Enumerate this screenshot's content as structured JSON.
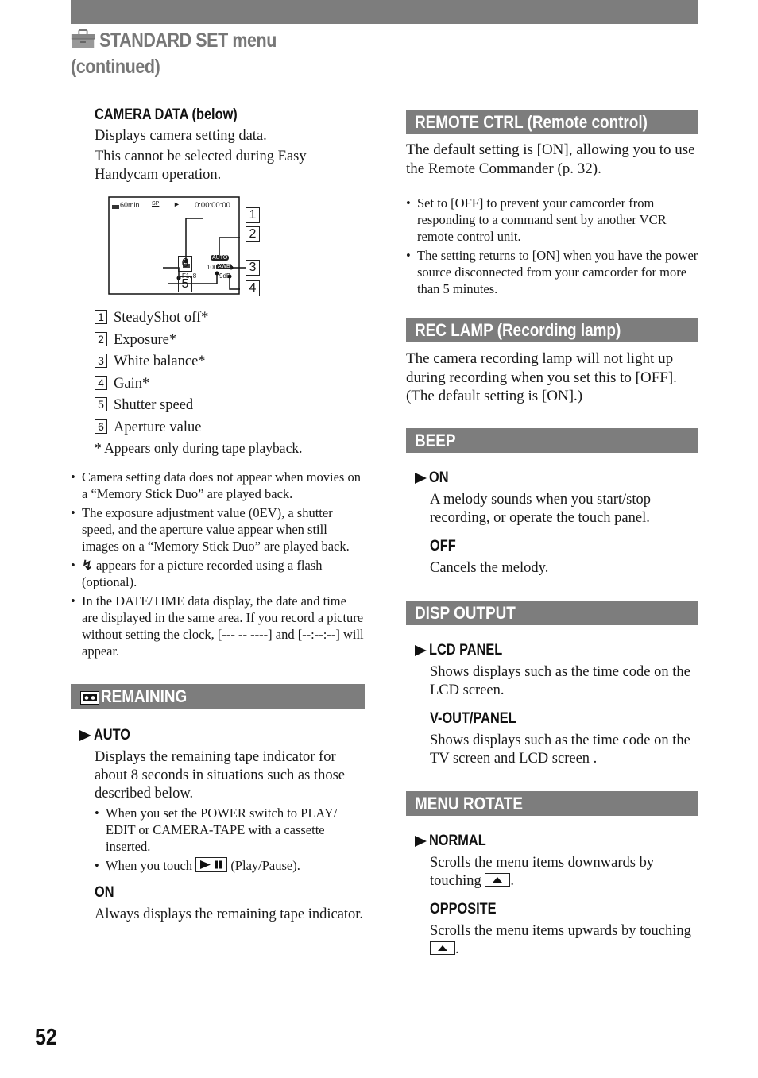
{
  "header": {
    "title_line1": "STANDARD SET menu",
    "title_line2": "(continued)",
    "icon": "toolbox-icon"
  },
  "camera_data": {
    "heading": "CAMERA DATA (below)",
    "desc1": "Displays camera setting data.",
    "desc2": "This cannot be selected during Easy Handycam operation.",
    "lcd": {
      "battery": "60min",
      "mode": "SP",
      "play_symbol": "►",
      "timecode": "0:00:00:00",
      "exposure": "AUTO",
      "white_balance": "AWB",
      "shutter": "100",
      "aperture": "F1. 8",
      "gain": "9dB",
      "callouts": [
        "1",
        "2",
        "3",
        "4",
        "5",
        "6"
      ]
    },
    "legend": [
      {
        "num": "1",
        "label": "SteadyShot off*"
      },
      {
        "num": "2",
        "label": "Exposure*"
      },
      {
        "num": "3",
        "label": "White balance*"
      },
      {
        "num": "4",
        "label": "Gain*"
      },
      {
        "num": "5",
        "label": "Shutter speed"
      },
      {
        "num": "6",
        "label": "Aperture value"
      }
    ],
    "footnote": "* Appears only during tape playback.",
    "notes": [
      "Camera setting data does not appear when movies on a “Memory Stick Duo” are played back.",
      "The exposure adjustment value (0EV), a shutter speed, and the aperture value appear when still images on a “Memory Stick Duo” are played back.",
      "appears for a picture recorded using a flash (optional).",
      "In the DATE/TIME data display, the date and time are displayed in the same area. If you record a picture without setting the clock, [--- -- ----] and [--:--:--] will appear."
    ]
  },
  "remaining": {
    "title": "REMAINING",
    "icon": "cassette-icon",
    "auto_label": "AUTO",
    "auto_desc": "Displays the remaining tape indicator for about 8 seconds in situations such as those described below.",
    "auto_bullets": [
      "When you set the POWER switch to PLAY/ EDIT or CAMERA-TAPE with a cassette inserted.",
      "When you touch",
      "(Play/Pause)."
    ],
    "on_label": "ON",
    "on_desc": "Always displays the remaining tape indicator."
  },
  "remote_ctrl": {
    "title": "REMOTE CTRL (Remote control)",
    "desc": "The default setting is [ON], allowing you to use the Remote Commander (p. 32).",
    "bullets": [
      "Set to [OFF] to prevent your camcorder from responding to a command sent by another VCR remote control unit.",
      "The setting returns to [ON] when you have the power source disconnected from your camcorder for more than 5 minutes."
    ]
  },
  "rec_lamp": {
    "title": "REC LAMP (Recording lamp)",
    "desc": "The camera recording lamp will not light up during recording when you set this to [OFF]. (The default setting is [ON].)"
  },
  "beep": {
    "title": "BEEP",
    "on_label": "ON",
    "on_desc": "A melody sounds when you start/stop recording, or operate the touch panel.",
    "off_label": "OFF",
    "off_desc": "Cancels the melody."
  },
  "disp_output": {
    "title": "DISP OUTPUT",
    "lcd_label": "LCD PANEL",
    "lcd_desc": "Shows displays such as the time code on the LCD screen.",
    "vout_label": "V-OUT/PANEL",
    "vout_desc": "Shows displays such as the time code on the TV screen and LCD screen ."
  },
  "menu_rotate": {
    "title": "MENU ROTATE",
    "normal_label": "NORMAL",
    "normal_desc": "Scrolls the menu items downwards by touching",
    "opposite_label": "OPPOSITE",
    "opposite_desc": "Scrolls the menu items upwards by touching",
    "period": "."
  },
  "page_number": "52",
  "colors": {
    "bar_gray": "#7d7d7d",
    "title_gray": "#777777"
  }
}
